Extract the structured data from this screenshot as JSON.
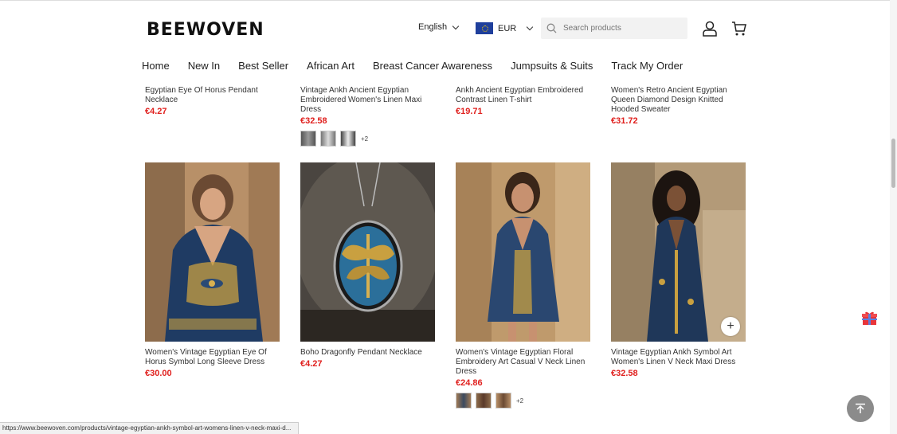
{
  "brand": {
    "logo_text": "BEEWOVEN"
  },
  "header": {
    "language": "English",
    "currency": "EUR",
    "search_placeholder": "Search products"
  },
  "nav": [
    "Home",
    "New In",
    "Best Seller",
    "African Art",
    "Breast Cancer Awareness",
    "Jumpsuits & Suits",
    "Track My Order"
  ],
  "products_row1": [
    {
      "title": "Egyptian Eye Of Horus Pendant Necklace",
      "price": "€4.27"
    },
    {
      "title": "Vintage Ankh Ancient Egyptian Embroidered Women's Linen Maxi Dress",
      "price": "€32.58",
      "more": "+2"
    },
    {
      "title": "Ankh Ancient Egyptian Embroidered Contrast Linen T-shirt",
      "price": "€19.71"
    },
    {
      "title": "Women's Retro Ancient Egyptian Queen Diamond Design Knitted Hooded Sweater",
      "price": "€31.72"
    }
  ],
  "products_row2": [
    {
      "title": "Women's Vintage Egyptian Eye Of Horus Symbol Long Sleeve Dress",
      "price": "€30.00"
    },
    {
      "title": "Boho Dragonfly Pendant Necklace",
      "price": "€4.27"
    },
    {
      "title": "Women's Vintage Egyptian Floral Embroidery Art Casual V Neck Linen Dress",
      "price": "€24.86",
      "more": "+2"
    },
    {
      "title": "Vintage Egyptian Ankh Symbol Art Women's Linen V Neck Maxi Dress",
      "price": "€32.58"
    }
  ],
  "status_url": "https://www.beewoven.com/products/vintage-egyptian-ankh-symbol-art-womens-linen-v-neck-maxi-d...",
  "colors": {
    "price": "#e0201e",
    "accent": "#1f3f9c"
  }
}
